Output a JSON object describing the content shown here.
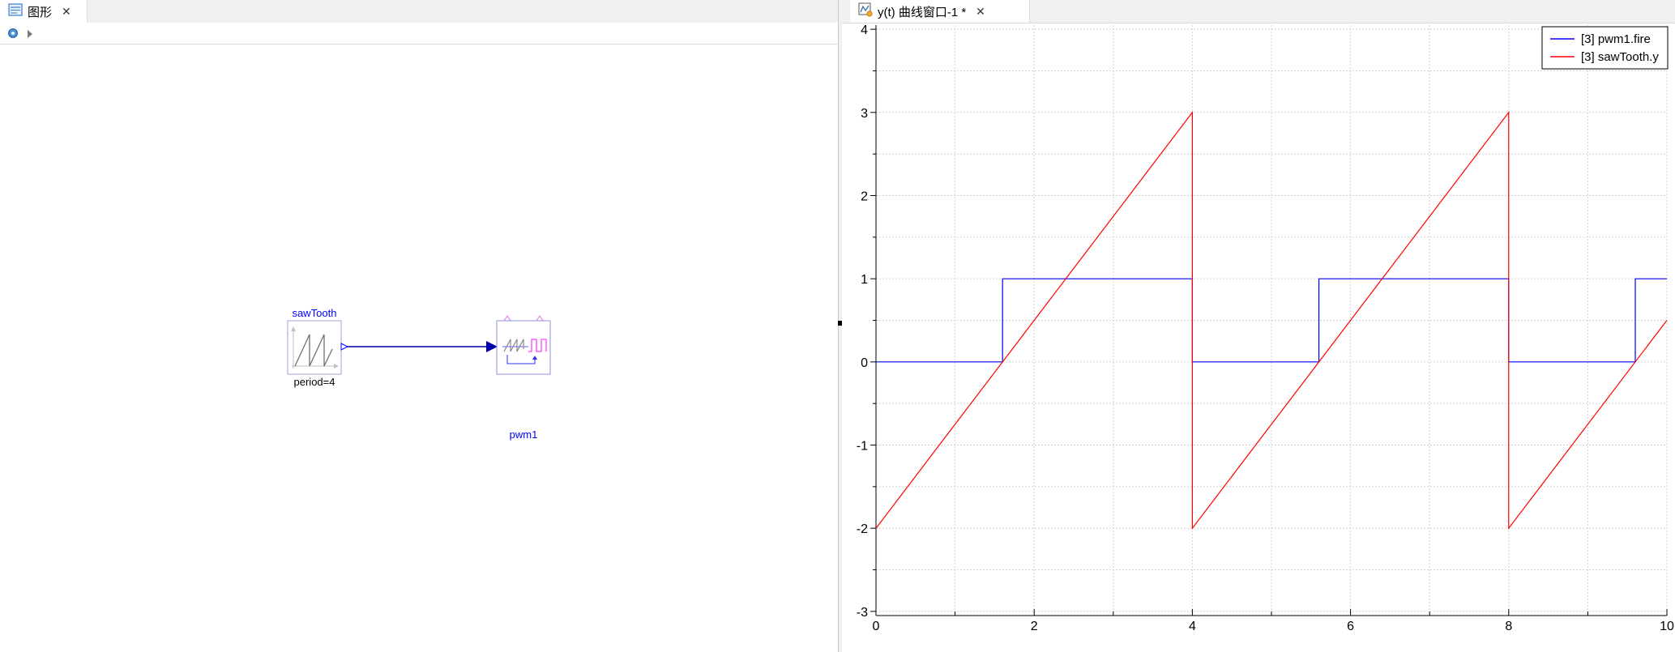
{
  "left_panel": {
    "tab": {
      "label": "图形",
      "close": "✕"
    },
    "diagram": {
      "sawtooth_block": {
        "name": "sawTooth",
        "param": "period=4"
      },
      "pwm_block": {
        "name": "pwm1"
      }
    }
  },
  "right_panel": {
    "tab": {
      "label": "y(t) 曲线窗口-1 *",
      "close": "✕"
    },
    "chart_data": {
      "type": "line",
      "title": "",
      "xlabel": "",
      "ylabel": "",
      "xlim": [
        0,
        10
      ],
      "ylim": [
        -3.05,
        4.05
      ],
      "x_ticks": [
        0,
        2,
        4,
        6,
        8,
        10
      ],
      "y_ticks": [
        -3,
        -2,
        -1,
        0,
        1,
        2,
        3,
        4
      ],
      "grid": true,
      "legend_position": "top-right",
      "series": [
        {
          "name": "[3] pwm1.fire",
          "color": "#0000ff",
          "x": [
            0,
            1.6,
            1.6,
            4.0,
            4.0,
            5.6,
            5.6,
            8.0,
            8.0,
            9.6,
            9.6,
            10
          ],
          "y": [
            0,
            0,
            1,
            1,
            0,
            0,
            1,
            1,
            0,
            0,
            1,
            1
          ]
        },
        {
          "name": "[3] sawTooth.y",
          "color": "#ff0000",
          "x": [
            0,
            4.0,
            4.0,
            8.0,
            8.0,
            10
          ],
          "y": [
            -2,
            3,
            -2,
            3,
            -2,
            0.5
          ]
        }
      ]
    }
  }
}
